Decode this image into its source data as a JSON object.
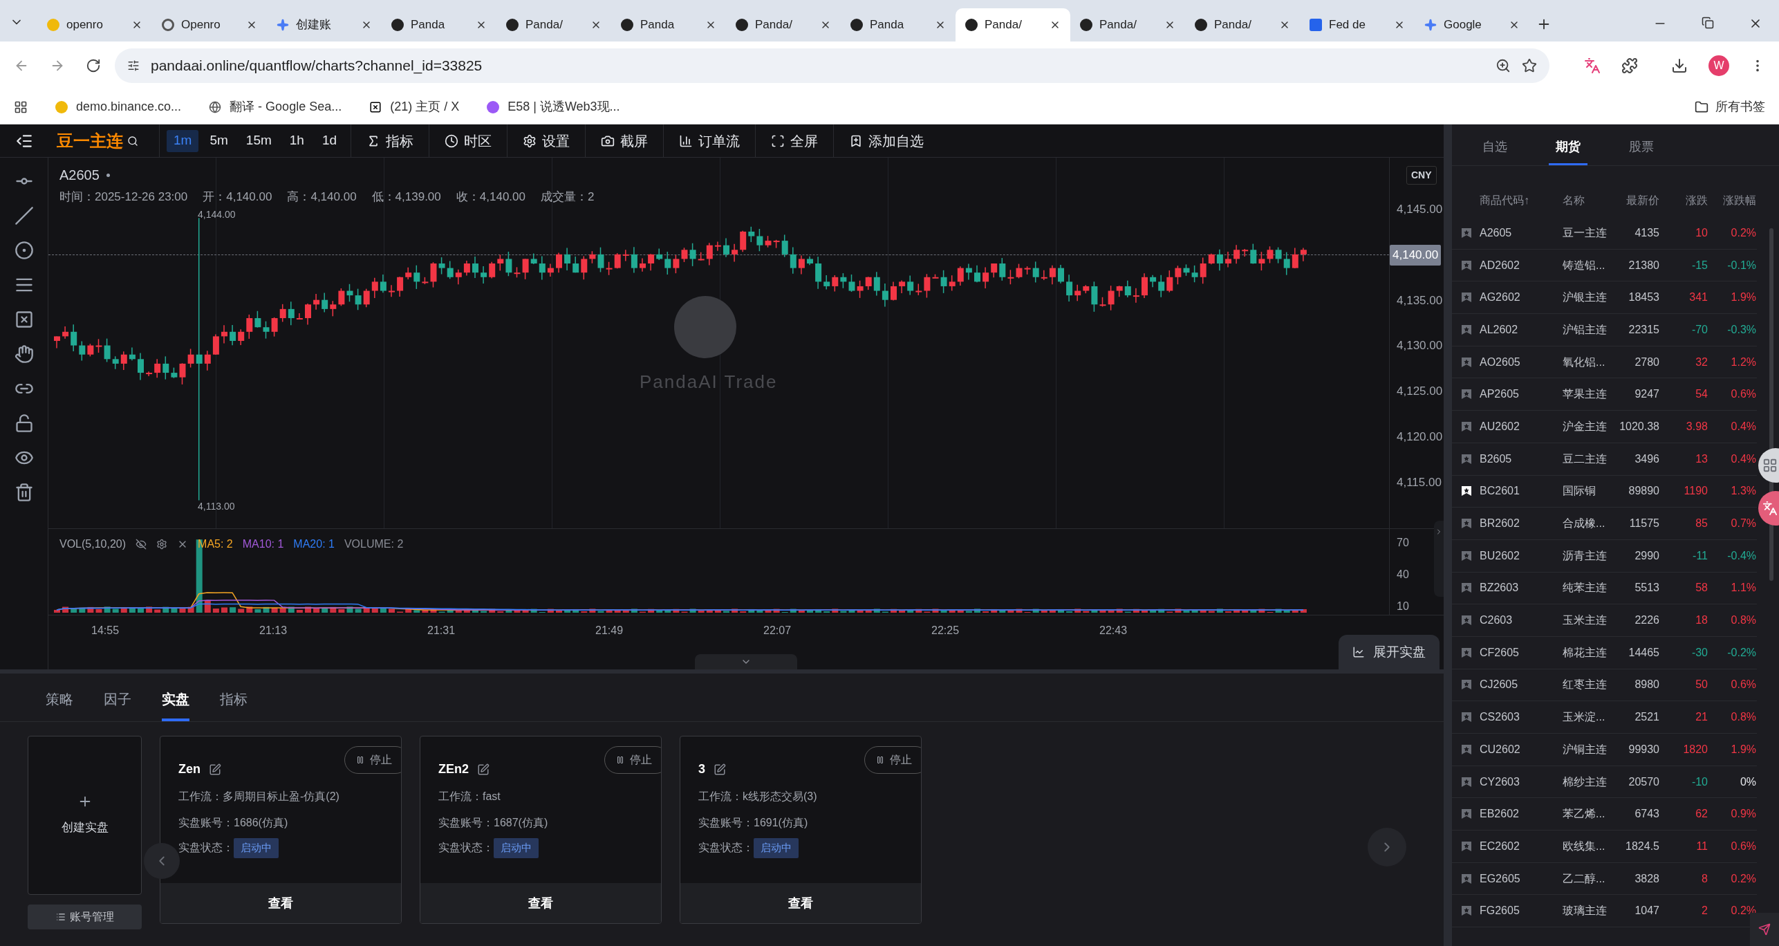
{
  "browser": {
    "tabs": [
      {
        "title": "openro",
        "selected": false
      },
      {
        "title": "Openro",
        "selected": false
      },
      {
        "title": "创建账",
        "selected": false
      },
      {
        "title": "Panda",
        "selected": false
      },
      {
        "title": "Panda/",
        "selected": false
      },
      {
        "title": "Panda",
        "selected": false
      },
      {
        "title": "Panda/",
        "selected": false
      },
      {
        "title": "Panda",
        "selected": false
      },
      {
        "title": "Panda/",
        "selected": true
      },
      {
        "title": "Panda/",
        "selected": false
      },
      {
        "title": "Panda/",
        "selected": false
      },
      {
        "title": "Fed de",
        "selected": false
      },
      {
        "title": "Google",
        "selected": false
      }
    ],
    "address": "pandaai.online/quantflow/charts?channel_id=33825",
    "profile": "W",
    "bookmarks": [
      "demo.binance.co...",
      "翻译 - Google Sea...",
      "(21) 主页 / X",
      "E58 | 说透Web3现..."
    ],
    "all_bookmarks": "所有书签"
  },
  "toolbar": {
    "symbol_name": "豆一主连",
    "intervals": [
      {
        "label": "1m",
        "selected": true
      },
      {
        "label": "5m",
        "selected": false
      },
      {
        "label": "15m",
        "selected": false
      },
      {
        "label": "1h",
        "selected": false
      },
      {
        "label": "1d",
        "selected": false
      }
    ],
    "actions": [
      "指标",
      "时区",
      "设置",
      "截屏",
      "订单流",
      "全屏",
      "添加自选"
    ]
  },
  "chart": {
    "symbol": "A2605",
    "info": [
      "时间：2025-12-26 23:00",
      "开：4,140.00",
      "高：4,140.00",
      "低：4,139.00",
      "收：4,140.00",
      "成交量：2"
    ],
    "high_label": "4,144.00",
    "low_label": "4,113.00",
    "currency": "CNY",
    "price_ticks": [
      "4,145.00",
      "4,135.00",
      "4,130.00",
      "4,125.00",
      "4,120.00",
      "4,115.00"
    ],
    "current_price": "4,140.00",
    "watermark": "PandaAI Trade",
    "volume": {
      "title": "VOL(5,10,20)",
      "legend": [
        {
          "label": "MA5: 2",
          "color": "#f5a623"
        },
        {
          "label": "MA10: 1",
          "color": "#a259d9"
        },
        {
          "label": "MA20: 1",
          "color": "#2f7cf6"
        },
        {
          "label": "VOLUME: 2",
          "color": "#8a8d96"
        }
      ],
      "ticks": [
        "70",
        "40",
        "10"
      ]
    },
    "time_ticks": [
      "14:55",
      "21:13",
      "21:31",
      "21:49",
      "22:07",
      "22:25",
      "22:43"
    ],
    "expand_button": "展开实盘"
  },
  "bottom": {
    "tabs": [
      {
        "label": "策略",
        "selected": false
      },
      {
        "label": "因子",
        "selected": false
      },
      {
        "label": "实盘",
        "selected": true
      },
      {
        "label": "指标",
        "selected": false
      }
    ],
    "create_label": "创建实盘",
    "account_button": "账号管理",
    "cards": [
      {
        "name": "Zen",
        "stop": "停止",
        "fields": [
          {
            "label": "工作流：",
            "value": "多周期目标止盈-仿真(2)"
          },
          {
            "label": "实盘账号：",
            "value": "1686(仿真)"
          }
        ],
        "status_label": "实盘状态：",
        "status": "启动中",
        "view": "查看"
      },
      {
        "name": "ZEn2",
        "stop": "停止",
        "fields": [
          {
            "label": "工作流：",
            "value": "fast"
          },
          {
            "label": "实盘账号：",
            "value": "1687(仿真)"
          }
        ],
        "status_label": "实盘状态：",
        "status": "启动中",
        "view": "查看"
      },
      {
        "name": "3",
        "stop": "停止",
        "fields": [
          {
            "label": "工作流：",
            "value": "k线形态交易(3)"
          },
          {
            "label": "实盘账号：",
            "value": "1691(仿真)"
          }
        ],
        "status_label": "实盘状态：",
        "status": "启动中",
        "view": "查看"
      }
    ]
  },
  "watchlist": {
    "tabs": [
      {
        "label": "自选",
        "selected": false
      },
      {
        "label": "期货",
        "selected": true
      },
      {
        "label": "股票",
        "selected": false
      }
    ],
    "columns": [
      "商品代码↑",
      "名称",
      "最新价",
      "涨跌",
      "涨跌幅"
    ],
    "rows": [
      {
        "code": "A2605",
        "name": "豆一主连",
        "price": "4135",
        "change": {
          "text": "10",
          "color": "#f23645"
        },
        "pct": {
          "text": "0.2%",
          "color": "#f23645"
        },
        "favorite": false
      },
      {
        "code": "AD2602",
        "name": "铸造铝...",
        "price": "21380",
        "change": {
          "text": "-15",
          "color": "#22ab94"
        },
        "pct": {
          "text": "-0.1%",
          "color": "#22ab94"
        },
        "favorite": false
      },
      {
        "code": "AG2602",
        "name": "沪银主连",
        "price": "18453",
        "change": {
          "text": "341",
          "color": "#f23645"
        },
        "pct": {
          "text": "1.9%",
          "color": "#f23645"
        },
        "favorite": false
      },
      {
        "code": "AL2602",
        "name": "沪铝主连",
        "price": "22315",
        "change": {
          "text": "-70",
          "color": "#22ab94"
        },
        "pct": {
          "text": "-0.3%",
          "color": "#22ab94"
        },
        "favorite": false
      },
      {
        "code": "AO2605",
        "name": "氧化铝...",
        "price": "2780",
        "change": {
          "text": "32",
          "color": "#f23645"
        },
        "pct": {
          "text": "1.2%",
          "color": "#f23645"
        },
        "favorite": false
      },
      {
        "code": "AP2605",
        "name": "苹果主连",
        "price": "9247",
        "change": {
          "text": "54",
          "color": "#f23645"
        },
        "pct": {
          "text": "0.6%",
          "color": "#f23645"
        },
        "favorite": false
      },
      {
        "code": "AU2602",
        "name": "沪金主连",
        "price": "1020.38",
        "change": {
          "text": "3.98",
          "color": "#f23645"
        },
        "pct": {
          "text": "0.4%",
          "color": "#f23645"
        },
        "favorite": false
      },
      {
        "code": "B2605",
        "name": "豆二主连",
        "price": "3496",
        "change": {
          "text": "13",
          "color": "#f23645"
        },
        "pct": {
          "text": "0.4%",
          "color": "#f23645"
        },
        "favorite": false
      },
      {
        "code": "BC2601",
        "name": "国际铜",
        "price": "89890",
        "change": {
          "text": "1190",
          "color": "#f23645"
        },
        "pct": {
          "text": "1.3%",
          "color": "#f23645"
        },
        "favorite": true
      },
      {
        "code": "BR2602",
        "name": "合成橡...",
        "price": "11575",
        "change": {
          "text": "85",
          "color": "#f23645"
        },
        "pct": {
          "text": "0.7%",
          "color": "#f23645"
        },
        "favorite": false
      },
      {
        "code": "BU2602",
        "name": "沥青主连",
        "price": "2990",
        "change": {
          "text": "-11",
          "color": "#22ab94"
        },
        "pct": {
          "text": "-0.4%",
          "color": "#22ab94"
        },
        "favorite": false
      },
      {
        "code": "BZ2603",
        "name": "纯苯主连",
        "price": "5513",
        "change": {
          "text": "58",
          "color": "#f23645"
        },
        "pct": {
          "text": "1.1%",
          "color": "#f23645"
        },
        "favorite": false
      },
      {
        "code": "C2603",
        "name": "玉米主连",
        "price": "2226",
        "change": {
          "text": "18",
          "color": "#f23645"
        },
        "pct": {
          "text": "0.8%",
          "color": "#f23645"
        },
        "favorite": false
      },
      {
        "code": "CF2605",
        "name": "棉花主连",
        "price": "14465",
        "change": {
          "text": "-30",
          "color": "#22ab94"
        },
        "pct": {
          "text": "-0.2%",
          "color": "#22ab94"
        },
        "favorite": false
      },
      {
        "code": "CJ2605",
        "name": "红枣主连",
        "price": "8980",
        "change": {
          "text": "50",
          "color": "#f23645"
        },
        "pct": {
          "text": "0.6%",
          "color": "#f23645"
        },
        "favorite": false
      },
      {
        "code": "CS2603",
        "name": "玉米淀...",
        "price": "2521",
        "change": {
          "text": "21",
          "color": "#f23645"
        },
        "pct": {
          "text": "0.8%",
          "color": "#f23645"
        },
        "favorite": false
      },
      {
        "code": "CU2602",
        "name": "沪铜主连",
        "price": "99930",
        "change": {
          "text": "1820",
          "color": "#f23645"
        },
        "pct": {
          "text": "1.9%",
          "color": "#f23645"
        },
        "favorite": false
      },
      {
        "code": "CY2603",
        "name": "棉纱主连",
        "price": "20570",
        "change": {
          "text": "-10",
          "color": "#22ab94"
        },
        "pct": {
          "text": "0%",
          "color": "#e5e7eb"
        },
        "favorite": false
      },
      {
        "code": "EB2602",
        "name": "苯乙烯...",
        "price": "6743",
        "change": {
          "text": "62",
          "color": "#f23645"
        },
        "pct": {
          "text": "0.9%",
          "color": "#f23645"
        },
        "favorite": false
      },
      {
        "code": "EC2602",
        "name": "欧线集...",
        "price": "1824.5",
        "change": {
          "text": "11",
          "color": "#f23645"
        },
        "pct": {
          "text": "0.6%",
          "color": "#f23645"
        },
        "favorite": false
      },
      {
        "code": "EG2605",
        "name": "乙二醇...",
        "price": "3828",
        "change": {
          "text": "8",
          "color": "#f23645"
        },
        "pct": {
          "text": "0.2%",
          "color": "#f23645"
        },
        "favorite": false
      },
      {
        "code": "FG2605",
        "name": "玻璃主连",
        "price": "1047",
        "change": {
          "text": "2",
          "color": "#f23645"
        },
        "pct": {
          "text": "0.2%",
          "color": "#f23645"
        },
        "favorite": false
      }
    ]
  }
}
